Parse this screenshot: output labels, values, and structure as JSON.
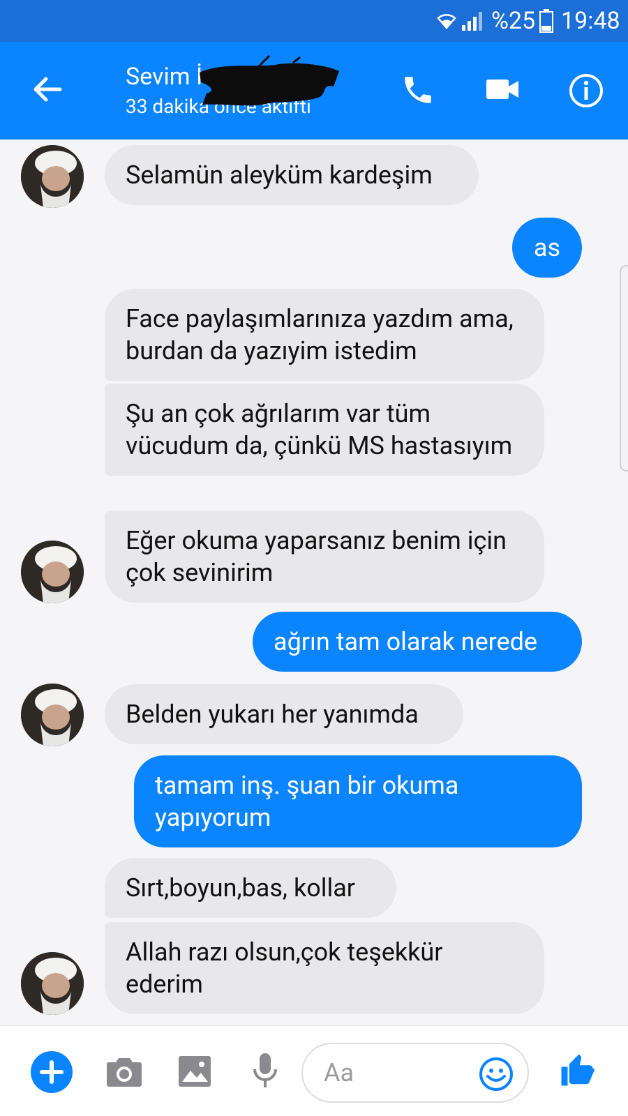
{
  "status_bar": {
    "battery_percent": "%25",
    "time": "19:48"
  },
  "header": {
    "contact_name": "Sevim İ",
    "active_status": "33 dakika önce aktifti"
  },
  "messages": [
    {
      "direction": "incoming",
      "text": "Selamün aleyküm kardeşim"
    },
    {
      "direction": "outgoing",
      "text": "as"
    },
    {
      "direction": "incoming",
      "text": "Face paylaşımlarınıza yazdım ama, burdan da yazıyim istedim"
    },
    {
      "direction": "incoming",
      "text": "Şu an çok ağrılarım var tüm vücudum da, çünkü MS hastasıyım"
    },
    {
      "direction": "incoming",
      "text": "Eğer okuma yaparsanız benim için çok sevinirim"
    },
    {
      "direction": "outgoing",
      "text": "ağrın tam olarak nerede"
    },
    {
      "direction": "incoming",
      "text": "Belden yukarı her yanımda"
    },
    {
      "direction": "outgoing",
      "text": "tamam inş. şuan bir okuma yapıyorum"
    },
    {
      "direction": "incoming",
      "text": "Sırt,boyun,bas, kollar"
    },
    {
      "direction": "incoming",
      "text": "Allah razı olsun,çok teşekkür ederim"
    }
  ],
  "composer": {
    "placeholder": "Aa"
  },
  "icons": {
    "back": "arrow-left-icon",
    "call": "phone-icon",
    "video": "video-camera-icon",
    "info": "info-icon",
    "plus": "plus-icon",
    "camera": "camera-icon",
    "image": "image-icon",
    "mic": "microphone-icon",
    "emoji": "smiley-icon",
    "like": "thumbs-up-icon"
  },
  "colors": {
    "accent": "#0a84ff",
    "status_bar": "#1b6fd6",
    "incoming_bubble": "#e8e8ea",
    "background": "#f5f5f7"
  }
}
